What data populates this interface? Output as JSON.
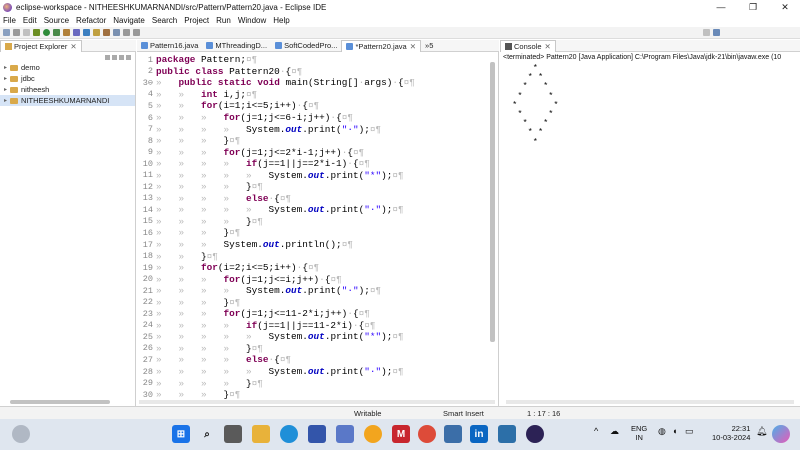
{
  "window": {
    "title": "eclipse-workspace - NITHEESHKUMARNANDI/src/Pattern/Pattern20.java - Eclipse IDE",
    "minimize": "—",
    "maximize": "❐",
    "close": "✕"
  },
  "menu": [
    "File",
    "Edit",
    "Source",
    "Refactor",
    "Navigate",
    "Search",
    "Project",
    "Run",
    "Window",
    "Help"
  ],
  "explorer": {
    "tab_label": "Project Explorer",
    "items": [
      "demo",
      "jdbc",
      "nitheesh",
      "NITHEESHKUMARNANDI"
    ]
  },
  "editor": {
    "tabs": [
      "Pattern16.java",
      "MThreadingD...",
      "SoftCodedPro...",
      "*Pattern20.java",
      "»5"
    ],
    "lines": [
      {
        "n": "1",
        "parts": [
          [
            "kw",
            "package"
          ],
          [
            "lt",
            " Pattern;"
          ],
          [
            "ws",
            "¤¶"
          ]
        ]
      },
      {
        "n": "2",
        "parts": [
          [
            "kw",
            "public"
          ],
          [
            "lt",
            " "
          ],
          [
            "kw",
            "class"
          ],
          [
            "lt",
            " Pattern20"
          ],
          [
            "ws",
            "·"
          ],
          [
            "lt",
            "{"
          ],
          [
            "ws",
            "¤¶"
          ]
        ]
      },
      {
        "n": "3⊖",
        "parts": [
          [
            "ws",
            "»   "
          ],
          [
            "kw",
            "public"
          ],
          [
            "lt",
            " "
          ],
          [
            "kw",
            "static"
          ],
          [
            "lt",
            " "
          ],
          [
            "kw",
            "void"
          ],
          [
            "lt",
            " main(String[]"
          ],
          [
            "ws",
            "·"
          ],
          [
            "lt",
            "args)"
          ],
          [
            "ws",
            "·"
          ],
          [
            "lt",
            "{"
          ],
          [
            "ws",
            "¤¶"
          ]
        ]
      },
      {
        "n": "4",
        "parts": [
          [
            "ws",
            "»   »   "
          ],
          [
            "kw",
            "int"
          ],
          [
            "lt",
            " i,j;"
          ],
          [
            "ws",
            "¤¶"
          ]
        ]
      },
      {
        "n": "5",
        "parts": [
          [
            "ws",
            "»   »   "
          ],
          [
            "kw",
            "for"
          ],
          [
            "lt",
            "(i=1;i<=5;i++)"
          ],
          [
            "ws",
            "·"
          ],
          [
            "lt",
            "{"
          ],
          [
            "ws",
            "¤¶"
          ]
        ]
      },
      {
        "n": "6",
        "parts": [
          [
            "ws",
            "»   »   »   "
          ],
          [
            "kw",
            "for"
          ],
          [
            "lt",
            "(j=1;j<=6-i;j++)"
          ],
          [
            "ws",
            "·"
          ],
          [
            "lt",
            "{"
          ],
          [
            "ws",
            "¤¶"
          ]
        ]
      },
      {
        "n": "7",
        "parts": [
          [
            "ws",
            "»   »   »   »   "
          ],
          [
            "lt",
            "System."
          ],
          [
            "fld",
            "out"
          ],
          [
            "lt",
            ".print("
          ],
          [
            "str",
            "\"·\""
          ],
          [
            "lt",
            ");"
          ],
          [
            "ws",
            "¤¶"
          ]
        ]
      },
      {
        "n": "8",
        "parts": [
          [
            "ws",
            "»   »   »   "
          ],
          [
            "lt",
            "}"
          ],
          [
            "ws",
            "¤¶"
          ]
        ]
      },
      {
        "n": "9",
        "parts": [
          [
            "ws",
            "»   »   »   "
          ],
          [
            "kw",
            "for"
          ],
          [
            "lt",
            "(j=1;j<=2*i-1;j++)"
          ],
          [
            "ws",
            "·"
          ],
          [
            "lt",
            "{"
          ],
          [
            "ws",
            "¤¶"
          ]
        ]
      },
      {
        "n": "10",
        "parts": [
          [
            "ws",
            "»   »   »   »   "
          ],
          [
            "kw",
            "if"
          ],
          [
            "lt",
            "(j==1||j==2*i-1)"
          ],
          [
            "ws",
            "·"
          ],
          [
            "lt",
            "{"
          ],
          [
            "ws",
            "¤¶"
          ]
        ]
      },
      {
        "n": "11",
        "parts": [
          [
            "ws",
            "»   »   »   »   »   "
          ],
          [
            "lt",
            "System."
          ],
          [
            "fld",
            "out"
          ],
          [
            "lt",
            ".print("
          ],
          [
            "str",
            "\"*\""
          ],
          [
            "lt",
            ");"
          ],
          [
            "ws",
            "¤¶"
          ]
        ]
      },
      {
        "n": "12",
        "parts": [
          [
            "ws",
            "»   »   »   »   "
          ],
          [
            "lt",
            "}"
          ],
          [
            "ws",
            "¤¶"
          ]
        ]
      },
      {
        "n": "13",
        "parts": [
          [
            "ws",
            "»   »   »   »   "
          ],
          [
            "kw",
            "else"
          ],
          [
            "ws",
            "·"
          ],
          [
            "lt",
            "{"
          ],
          [
            "ws",
            "¤¶"
          ]
        ]
      },
      {
        "n": "14",
        "parts": [
          [
            "ws",
            "»   »   »   »   »   "
          ],
          [
            "lt",
            "System."
          ],
          [
            "fld",
            "out"
          ],
          [
            "lt",
            ".print("
          ],
          [
            "str",
            "\"·\""
          ],
          [
            "lt",
            ");"
          ],
          [
            "ws",
            "¤¶"
          ]
        ]
      },
      {
        "n": "15",
        "parts": [
          [
            "ws",
            "»   »   »   »   "
          ],
          [
            "lt",
            "}"
          ],
          [
            "ws",
            "¤¶"
          ]
        ]
      },
      {
        "n": "16",
        "parts": [
          [
            "ws",
            "»   »   »   "
          ],
          [
            "lt",
            "}"
          ],
          [
            "ws",
            "¤¶"
          ]
        ]
      },
      {
        "n": "17",
        "parts": [
          [
            "ws",
            "»   »   »   "
          ],
          [
            "lt",
            "System."
          ],
          [
            "fld",
            "out"
          ],
          [
            "lt",
            ".println();"
          ],
          [
            "ws",
            "¤¶"
          ]
        ]
      },
      {
        "n": "18",
        "parts": [
          [
            "ws",
            "»   »   "
          ],
          [
            "lt",
            "}"
          ],
          [
            "ws",
            "¤¶"
          ]
        ]
      },
      {
        "n": "19",
        "parts": [
          [
            "ws",
            "»   »   "
          ],
          [
            "kw",
            "for"
          ],
          [
            "lt",
            "(i=2;i<=5;i++)"
          ],
          [
            "ws",
            "·"
          ],
          [
            "lt",
            "{"
          ],
          [
            "ws",
            "¤¶"
          ]
        ]
      },
      {
        "n": "20",
        "parts": [
          [
            "ws",
            "»   »   »   "
          ],
          [
            "kw",
            "for"
          ],
          [
            "lt",
            "(j=1;j<=i;j++)"
          ],
          [
            "ws",
            "·"
          ],
          [
            "lt",
            "{"
          ],
          [
            "ws",
            "¤¶"
          ]
        ]
      },
      {
        "n": "21",
        "parts": [
          [
            "ws",
            "»   »   »   »   "
          ],
          [
            "lt",
            "System."
          ],
          [
            "fld",
            "out"
          ],
          [
            "lt",
            ".print("
          ],
          [
            "str",
            "\"·\""
          ],
          [
            "lt",
            ");"
          ],
          [
            "ws",
            "¤¶"
          ]
        ]
      },
      {
        "n": "22",
        "parts": [
          [
            "ws",
            "»   »   »   "
          ],
          [
            "lt",
            "}"
          ],
          [
            "ws",
            "¤¶"
          ]
        ]
      },
      {
        "n": "23",
        "parts": [
          [
            "ws",
            "»   »   »   "
          ],
          [
            "kw",
            "for"
          ],
          [
            "lt",
            "(j=1;j<=11-2*i;j++)"
          ],
          [
            "ws",
            "·"
          ],
          [
            "lt",
            "{"
          ],
          [
            "ws",
            "¤¶"
          ]
        ]
      },
      {
        "n": "24",
        "parts": [
          [
            "ws",
            "»   »   »   »   "
          ],
          [
            "kw",
            "if"
          ],
          [
            "lt",
            "(j==1||j==11-2*i)"
          ],
          [
            "ws",
            "·"
          ],
          [
            "lt",
            "{"
          ],
          [
            "ws",
            "¤¶"
          ]
        ]
      },
      {
        "n": "25",
        "parts": [
          [
            "ws",
            "»   »   »   »   »   "
          ],
          [
            "lt",
            "System."
          ],
          [
            "fld",
            "out"
          ],
          [
            "lt",
            ".print("
          ],
          [
            "str",
            "\"*\""
          ],
          [
            "lt",
            ");"
          ],
          [
            "ws",
            "¤¶"
          ]
        ]
      },
      {
        "n": "26",
        "parts": [
          [
            "ws",
            "»   »   »   »   "
          ],
          [
            "lt",
            "}"
          ],
          [
            "ws",
            "¤¶"
          ]
        ]
      },
      {
        "n": "27",
        "parts": [
          [
            "ws",
            "»   »   »   »   "
          ],
          [
            "kw",
            "else"
          ],
          [
            "ws",
            "·"
          ],
          [
            "lt",
            "{"
          ],
          [
            "ws",
            "¤¶"
          ]
        ]
      },
      {
        "n": "28",
        "parts": [
          [
            "ws",
            "»   »   »   »   »   "
          ],
          [
            "lt",
            "System."
          ],
          [
            "fld",
            "out"
          ],
          [
            "lt",
            ".print("
          ],
          [
            "str",
            "\"·\""
          ],
          [
            "lt",
            ");"
          ],
          [
            "ws",
            "¤¶"
          ]
        ]
      },
      {
        "n": "29",
        "parts": [
          [
            "ws",
            "»   »   »   »   "
          ],
          [
            "lt",
            "}"
          ],
          [
            "ws",
            "¤¶"
          ]
        ]
      },
      {
        "n": "30",
        "parts": [
          [
            "ws",
            "»   »   »   "
          ],
          [
            "lt",
            "}"
          ],
          [
            "ws",
            "¤¶"
          ]
        ]
      }
    ]
  },
  "console": {
    "tab_label": "Console",
    "terminated": "<terminated> Pattern20 [Java Application] C:\\Program Files\\Java\\jdk-21\\bin\\javaw.exe  (10",
    "output": "     *\n    * *\n   *   *\n  *     *\n *       *\n  *     *\n   *   *\n    * *\n     *"
  },
  "status": {
    "mode": "Writable",
    "insert": "Smart Insert",
    "position": "1 : 17 : 16"
  },
  "taskbar": {
    "lang": "ENG",
    "region": "IN",
    "time": "22:31",
    "date": "10-03-2024"
  }
}
